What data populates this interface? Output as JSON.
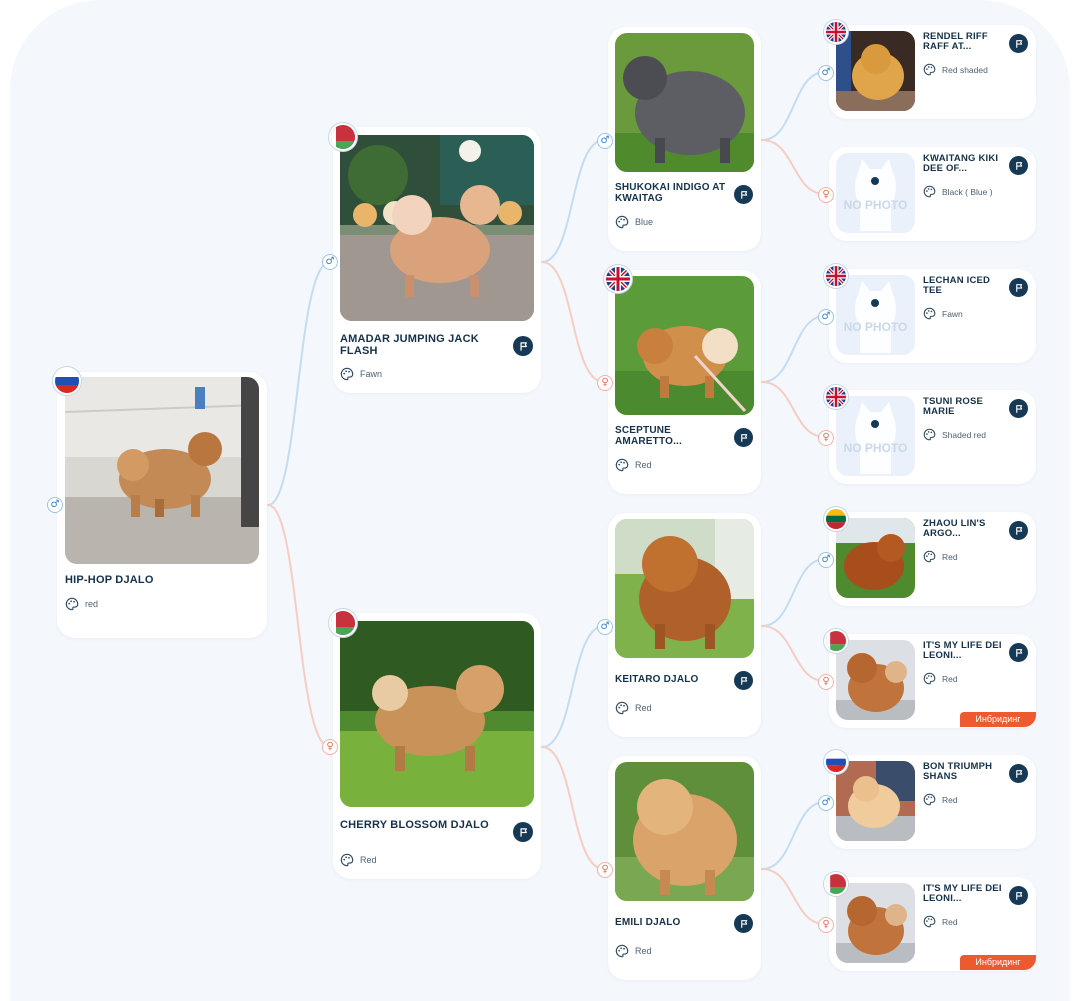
{
  "badges": {
    "inbreeding": "Инбридинг"
  },
  "no_photo_label": "NO PHOTO",
  "colors": {
    "male_line": "#c4dcef",
    "female_line": "#f6cdc3",
    "accent": "#163a55",
    "badge": "#ee5a30"
  },
  "pedigree": {
    "subject": {
      "name": "HIP-HOP DJALO",
      "color": "red",
      "sex": "male",
      "country": "Russia"
    },
    "parents": [
      {
        "name": "AMADAR JUMPING JACK FLASH",
        "color": "Fawn",
        "sex": "male",
        "country": "Belarus"
      },
      {
        "name": "CHERRY BLOSSOM DJALO",
        "color": "Red",
        "sex": "female",
        "country": "Belarus"
      }
    ],
    "grandparents": [
      {
        "name": "SHUKOKAI INDIGO AT KWAITAG",
        "color": "Blue",
        "sex": "male"
      },
      {
        "name": "SCEPTUNE AMARETTO...",
        "color": "Red",
        "sex": "female",
        "country": "United Kingdom"
      },
      {
        "name": "KEITARO DJALO",
        "color": "Red",
        "sex": "male"
      },
      {
        "name": "EMILI DJALO",
        "color": "Red",
        "sex": "female"
      }
    ],
    "great_grandparents": [
      {
        "name": "RENDEL RIFF RAFF AT...",
        "color": "Red shaded",
        "sex": "male",
        "country": "United Kingdom"
      },
      {
        "name": "KWAITANG KIKI DEE OF...",
        "color": "Black ( Blue )",
        "sex": "female"
      },
      {
        "name": "LECHAN ICED TEE",
        "color": "Fawn",
        "sex": "male",
        "country": "United Kingdom"
      },
      {
        "name": "TSUNI ROSE MARIE",
        "color": "Shaded red",
        "sex": "female",
        "country": "United Kingdom"
      },
      {
        "name": "ZHAOU LIN'S ARGO...",
        "color": "Red",
        "sex": "male",
        "country": "Lithuania"
      },
      {
        "name": "IT'S MY LIFE DEI LEONI...",
        "color": "Red",
        "sex": "female",
        "country": "Belarus",
        "inbreeding": true
      },
      {
        "name": "BON TRIUMPH SHANS",
        "color": "Red",
        "sex": "male",
        "country": "Russia"
      },
      {
        "name": "IT'S MY LIFE DEI LEONI...",
        "color": "Red",
        "sex": "female",
        "country": "Belarus",
        "inbreeding": true
      }
    ]
  }
}
